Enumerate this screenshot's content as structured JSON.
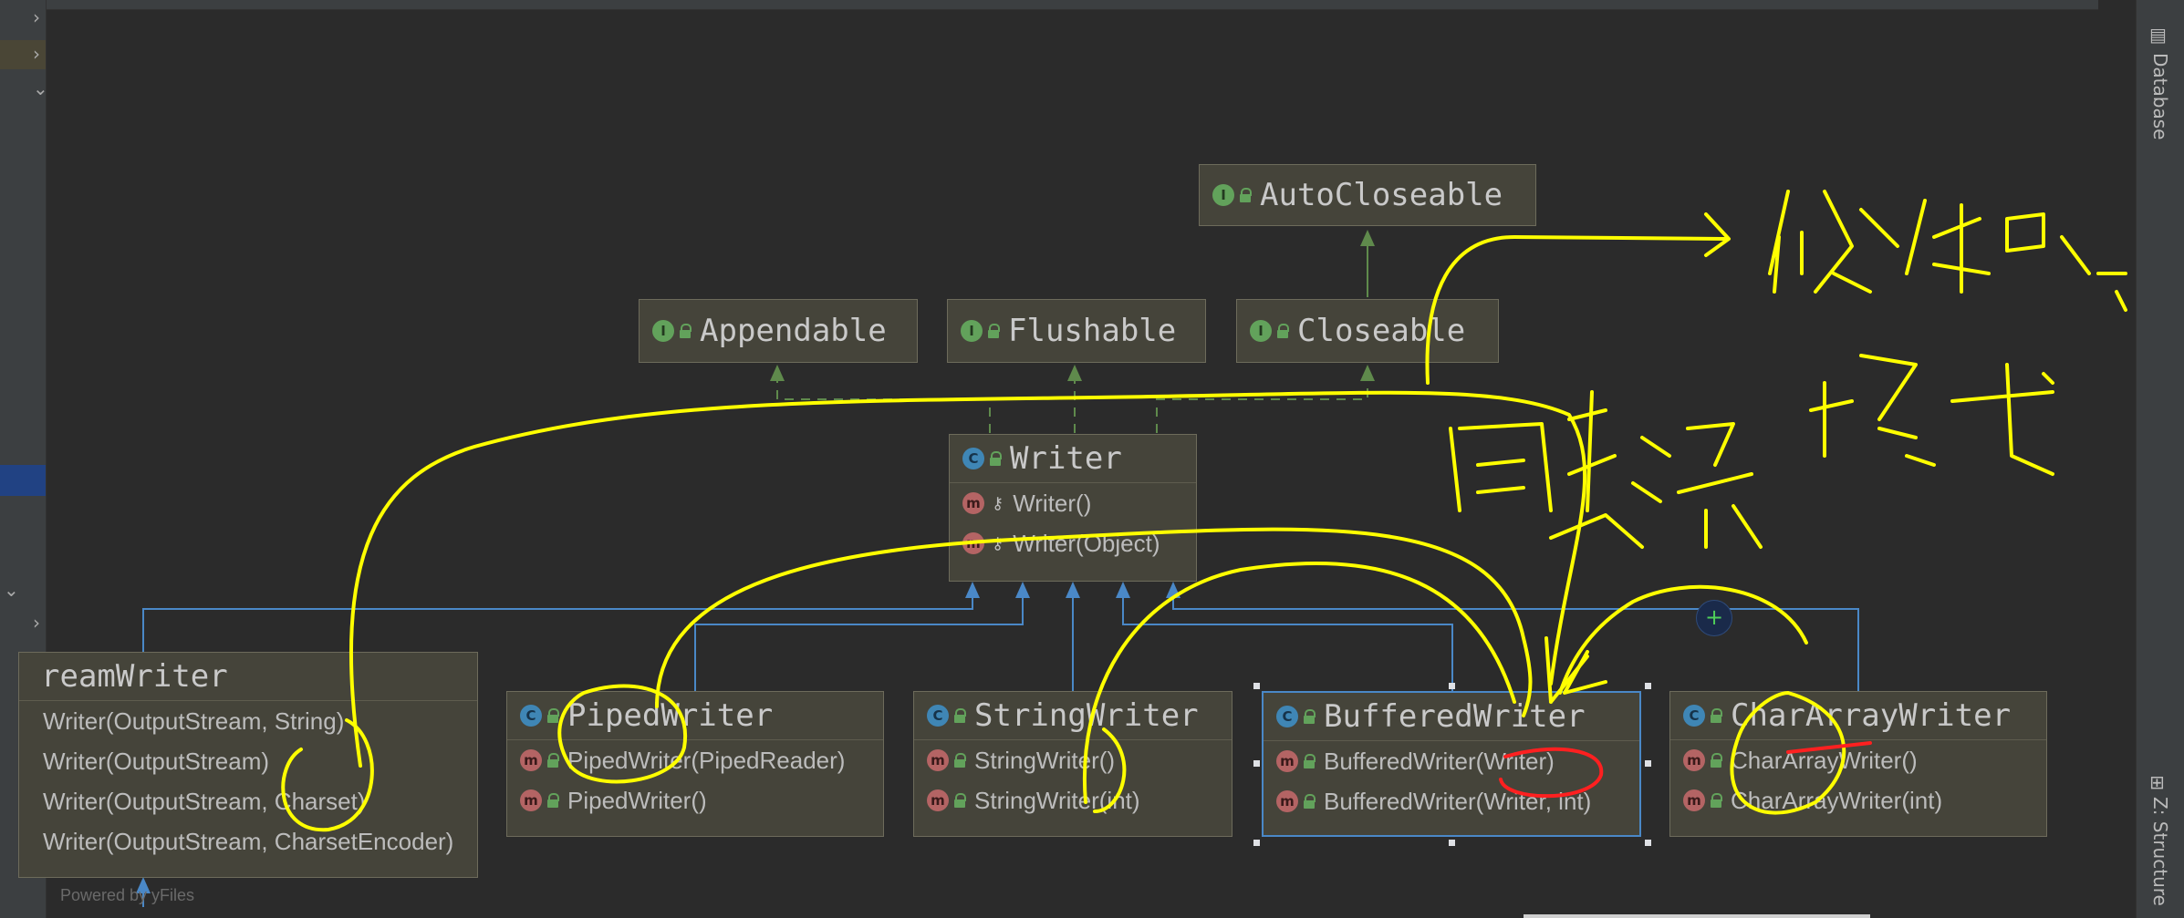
{
  "nodes": {
    "autocloseable": {
      "title": "AutoCloseable",
      "icon": "interface-icon"
    },
    "appendable": {
      "title": "Appendable",
      "icon": "interface-icon"
    },
    "flushable": {
      "title": "Flushable",
      "icon": "interface-icon"
    },
    "closeable": {
      "title": "Closeable",
      "icon": "interface-icon"
    },
    "writer": {
      "title": "Writer",
      "icon": "abstract-class-icon",
      "members": [
        "Writer()",
        "Writer(Object)"
      ]
    },
    "outputstreamwriter": {
      "title": "reamWriter",
      "icon": "class-icon",
      "members": [
        "Writer(OutputStream, String)",
        "Writer(OutputStream)",
        "Writer(OutputStream, Charset)",
        "Writer(OutputStream, CharsetEncoder)"
      ]
    },
    "pipedwriter": {
      "title": "PipedWriter",
      "icon": "class-icon",
      "members": [
        "PipedWriter(PipedReader)",
        "PipedWriter()"
      ]
    },
    "stringwriter": {
      "title": "StringWriter",
      "icon": "class-icon",
      "members": [
        "StringWriter()",
        "StringWriter(int)"
      ]
    },
    "bufferedwriter": {
      "title": "BufferedWriter",
      "icon": "class-icon",
      "members": [
        "BufferedWriter(Writer)",
        "BufferedWriter(Writer, int)"
      ]
    },
    "chararraywriter": {
      "title": "CharArrayWriter",
      "icon": "class-icon",
      "members": [
        "CharArrayWriter()",
        "CharArrayWriter(int)"
      ]
    }
  },
  "annotations": {
    "decorator_pattern": "修饰器模式",
    "same_type_stream": "同类流"
  },
  "tool_windows": {
    "database": "Database",
    "structure": "Z: Structure"
  },
  "powered_by": "Powered by yFiles",
  "colors": {
    "background": "#2b2b2b",
    "node_fill": "#45443a",
    "inherit_arrow": "#4a88c7",
    "implement_arrow": "#5f8a4c",
    "handwriting_yellow": "#ffff00",
    "handwriting_red": "#ff2020"
  }
}
